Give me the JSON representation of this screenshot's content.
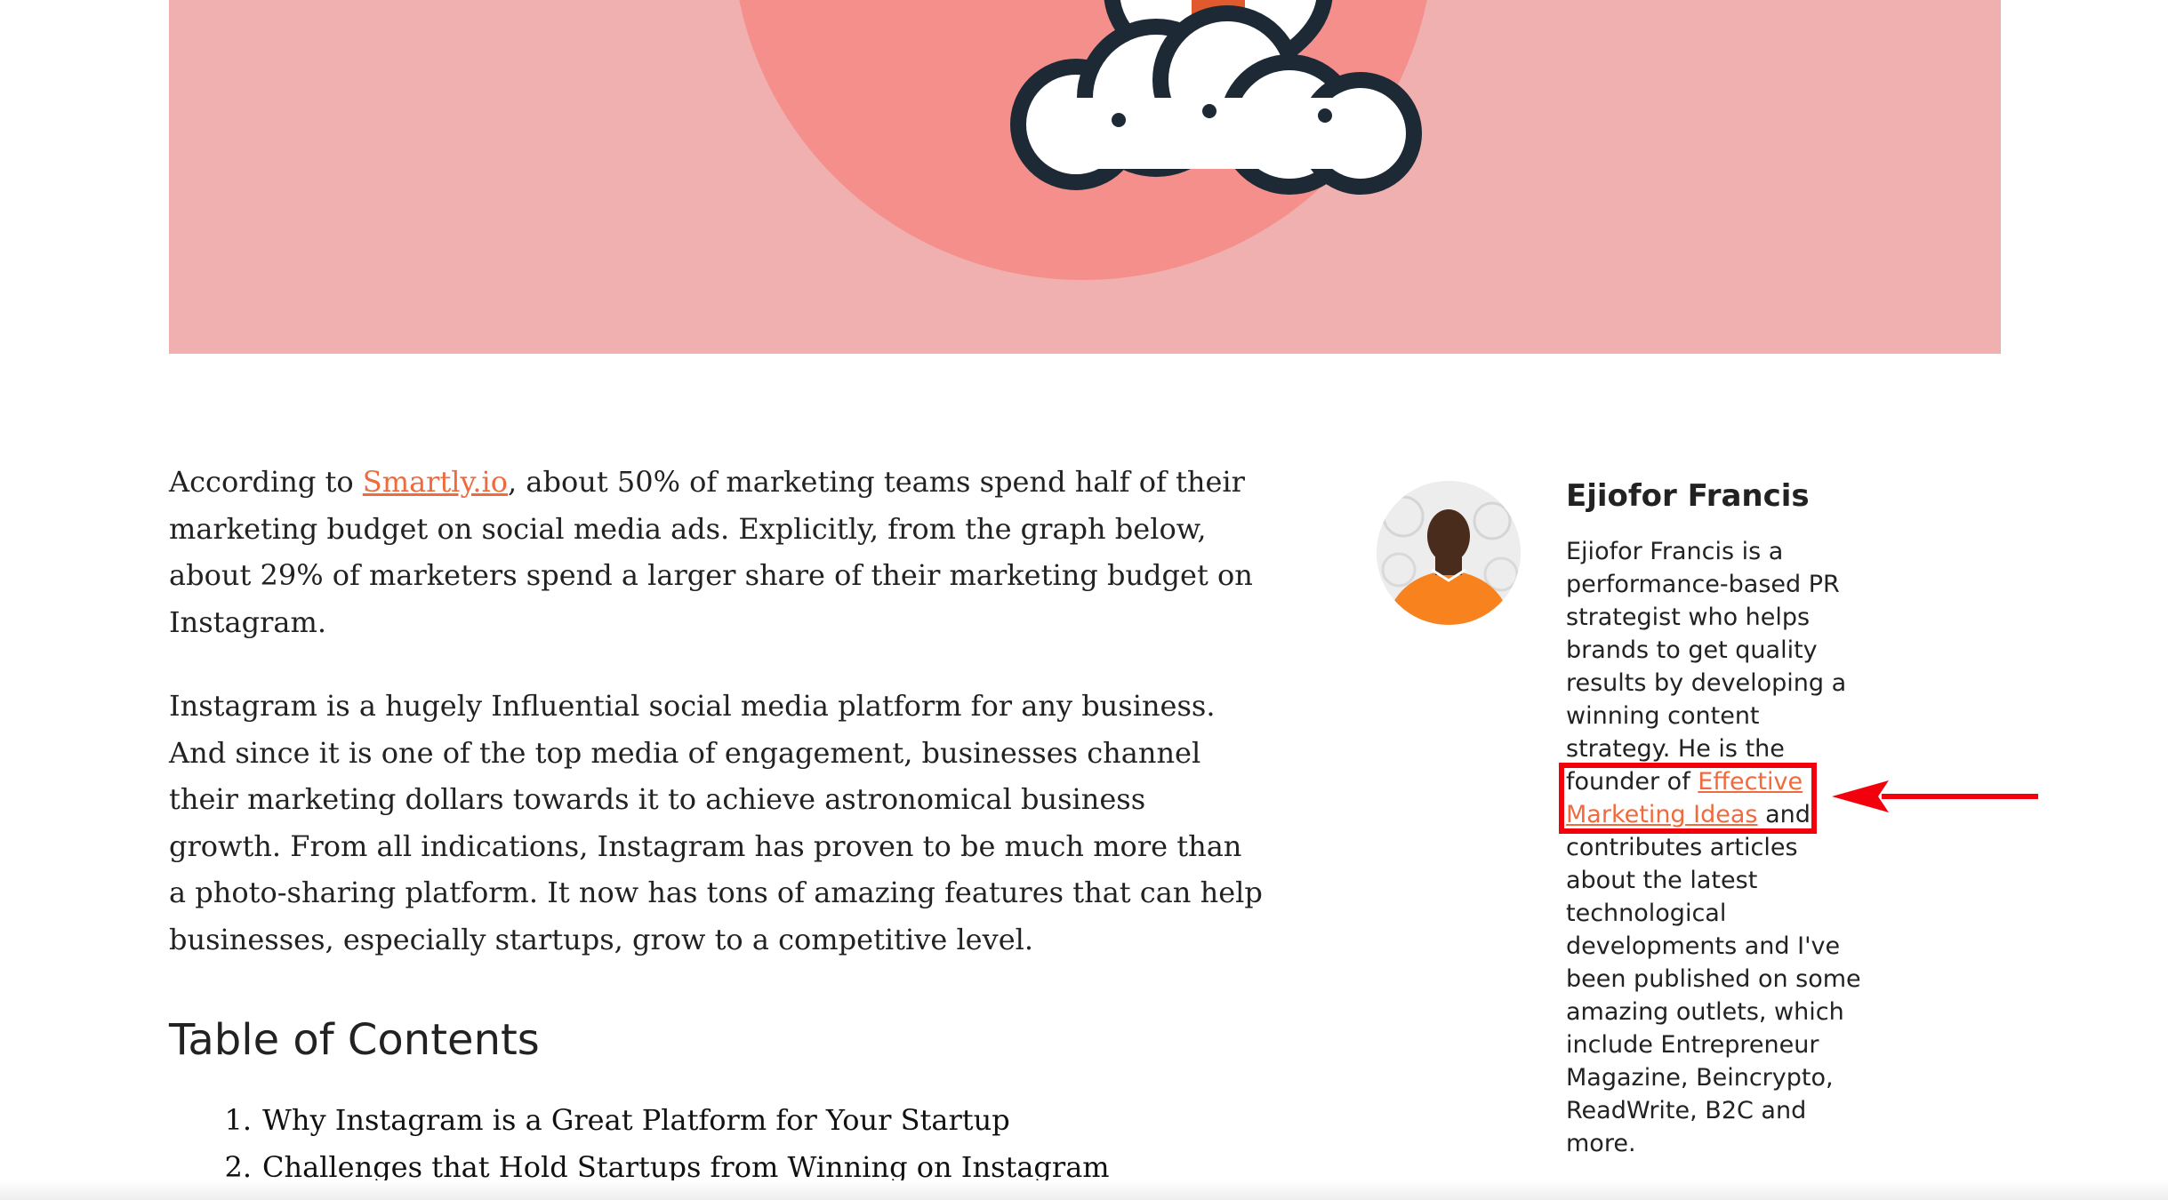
{
  "hero": {
    "background_color": "#efb0af",
    "circle_color": "#f58f8c",
    "illustration": "rocket-launch-clouds"
  },
  "article": {
    "paragraph1": {
      "before_link": "According to ",
      "link_text": "Smartly.io",
      "after_link": ", about 50% of marketing teams spend half of their marketing budget on social media ads. Explicitly, from the graph below, about 29% of marketers spend a larger share of their marketing budget on Instagram."
    },
    "paragraph2": "Instagram is a hugely Influential social media platform for any business. And since it is one of the top media of engagement, businesses channel their marketing dollars towards it to achieve astronomical business growth. From all indications, Instagram has proven to be much more than a photo-sharing platform. It now has tons of amazing features that can help businesses, especially startups, grow to a competitive level."
  },
  "toc": {
    "title": "Table of Contents",
    "items": [
      {
        "number": "1.",
        "label": "Why Instagram is a Great Platform for Your Startup"
      },
      {
        "number": "2.",
        "label": "Challenges that Hold Startups from Winning on Instagram"
      }
    ]
  },
  "author": {
    "name": "Ejiofor Francis",
    "bio_before": "Ejiofor Francis is a performance-based PR strategist who helps brands to get quality results by developing a winning content strategy. He is the founder of ",
    "bio_link": "Effective Marketing Ideas",
    "bio_after": " and contributes articles about the latest technological developments and I've been published on some amazing outlets, which include Entrepreneur Magazine, Beincrypto, ReadWrite, B2C and more."
  },
  "colors": {
    "link": "#ef6a3d",
    "annotation": "#f2000b",
    "text": "#222222"
  }
}
